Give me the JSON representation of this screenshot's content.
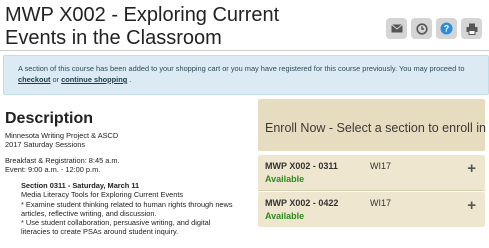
{
  "page": {
    "title": "MWP X002 - Exploring Current Events in the Classroom"
  },
  "toolbar": {
    "email_icon": "envelope-icon",
    "history_icon": "clock-icon",
    "help_icon": "help-icon",
    "print_icon": "printer-icon"
  },
  "notice": {
    "text_before": "A section of this course has been added to your shopping cart or you may have registered for this course previously. You may proceed to",
    "checkout_link": "checkout",
    "or": " or ",
    "continue_link": "continue shopping",
    "period": " ."
  },
  "description": {
    "heading": "Description",
    "line1": "Minnesota Writing Project & ASCD",
    "line2": "2017 Saturday Sessions",
    "line3": "Breakfast & Registration: 8:45 a.m.",
    "line4": "Event: 9:00 a.m. - 12:00 p.m.",
    "session_title": "Section 0311 - Saturday, March 11",
    "session_line1": "Media Literacy Tools for Exploring Current Events",
    "session_line2": "* Examine student thinking related to human rights through news",
    "session_line3": "articles, reflective writing, and discussion.",
    "session_line4": "* Use student collaboration, persuasive writing, and digital",
    "session_line5": "literacies to create PSAs around student inquiry."
  },
  "enroll": {
    "heading": "Enroll Now - Select a section to enroll in",
    "sections": [
      {
        "code": "MWP X002 - 0311",
        "term": "WI17",
        "status": "Available",
        "action": "+"
      },
      {
        "code": "MWP X002 - 0422",
        "term": "WI17",
        "status": "Available",
        "action": "+"
      }
    ]
  },
  "colors": {
    "notice_bg": "#dbeaf3",
    "enroll_bg": "#e6dcbf",
    "section_bg": "#eee6cf",
    "available": "#2f8a1f"
  }
}
